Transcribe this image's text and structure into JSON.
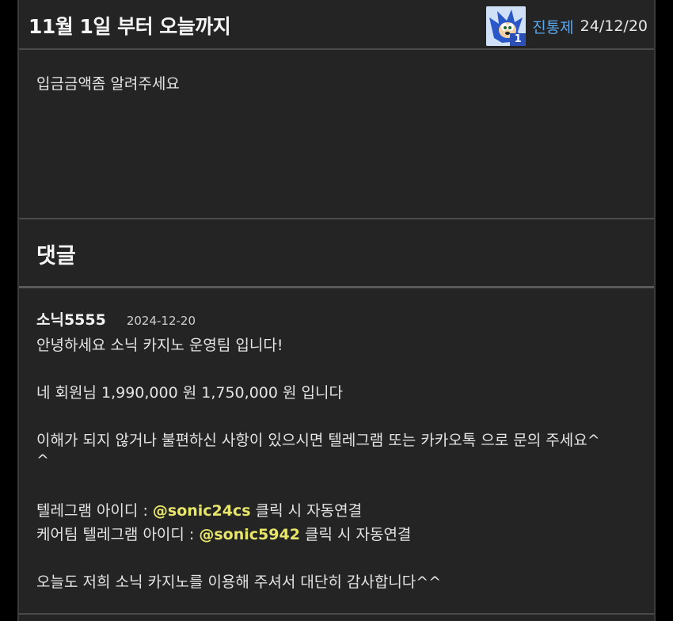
{
  "post": {
    "title": "11월 1일 부터 오늘까지",
    "author": "진통제",
    "author_badge": "1",
    "date": "24/12/20",
    "body": "입금금액좀 알려주세요"
  },
  "comments": {
    "title": "댓글",
    "items": [
      {
        "author": "소닉5555",
        "date": "2024-12-20",
        "line1": "안녕하세요 소닉 카지노 운영팀 입니다!",
        "line2": "네 회원님 1,990,000 원 1,750,000 원 입니다",
        "line3": "이해가 되지 않거나 불편하신 사항이 있으시면 텔레그램 또는 카카오톡 으로 문의 주세요^",
        "line3b": "^",
        "tg_prefix": "텔레그램 아이디 : ",
        "tg_handle": "@sonic24cs",
        "tg_suffix": " 클릭 시 자동연결",
        "care_prefix": "케어팀 텔레그램 아이디 : ",
        "care_handle": "@sonic5942",
        "care_suffix": " 클릭 시 자동연결",
        "closing": "오늘도 저희 소닉 카지노를 이용해 주셔서 대단히 감사합니다^^"
      }
    ]
  },
  "colors": {
    "background": "#242424",
    "author_link": "#5aa8f0",
    "handle_highlight": "#e8e66a"
  },
  "icons": {
    "avatar": "sonic-avatar-icon"
  }
}
